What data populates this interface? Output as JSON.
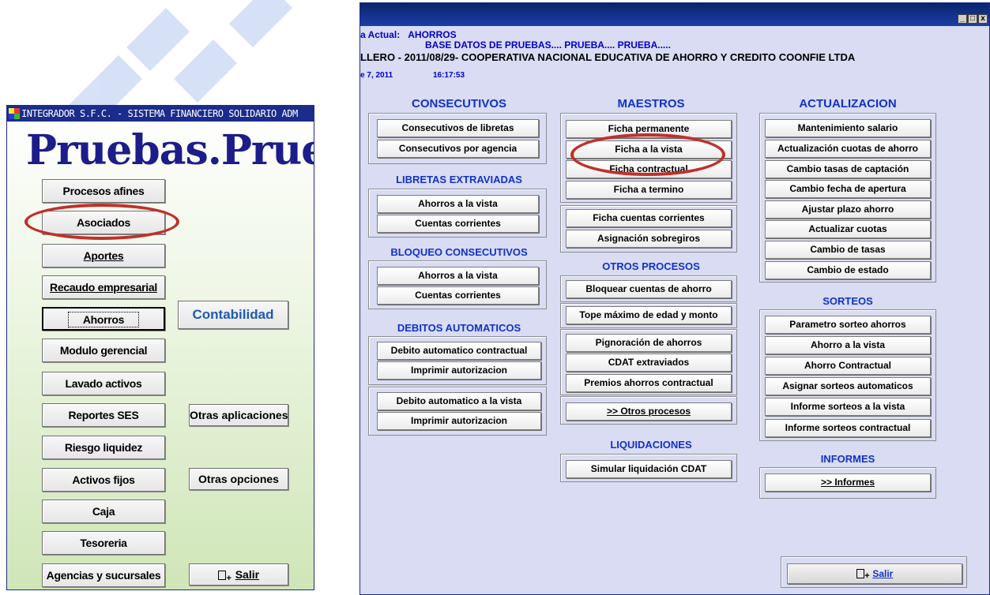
{
  "left_window": {
    "title": "INTEGRADOR  S.F.C. - SISTEMA FINANCIERO SOLIDARIO ADM",
    "app_name": "Pruebas.Prueb",
    "buttons_col1": [
      {
        "label": "Procesos afines"
      },
      {
        "label": "Asociados"
      },
      {
        "label": "Aportes"
      },
      {
        "label": "Recaudo empresarial"
      },
      {
        "label": "Ahorros"
      },
      {
        "label": "Modulo gerencial"
      },
      {
        "label": "Lavado activos"
      },
      {
        "label": "Reportes SES"
      },
      {
        "label": "Riesgo liquidez"
      },
      {
        "label": "Activos fijos"
      },
      {
        "label": "Caja"
      },
      {
        "label": "Tesoreria"
      },
      {
        "label": "Agencias y sucursales"
      }
    ],
    "contabilidad_label": "Contabilidad",
    "otras_aplicaciones_label": "Otras aplicaciones",
    "otras_opciones_label": "Otras opciones",
    "salir_label": "Salir"
  },
  "right_window": {
    "header": {
      "line1_label": "a Actual:",
      "line1_value": "AHORROS",
      "line2": "BASE DATOS DE PRUEBAS.... PRUEBA.... PRUEBA.....",
      "line3": "LLERO - 2011/08/29- COOPERATIVA NACIONAL EDUCATIVA DE AHORRO Y CREDITO COONFIE LTDA",
      "date": "e 7, 2011",
      "time": "16:17:53"
    },
    "consecutivos": {
      "title": "CONSECUTIVOS",
      "buttons": [
        "Consecutivos de libretas",
        "Consecutivos por agencia"
      ]
    },
    "libretas_extraviadas": {
      "title": "LIBRETAS EXTRAVIADAS",
      "buttons": [
        "Ahorros a la vista",
        "Cuentas corrientes"
      ]
    },
    "bloqueo_consecutivos": {
      "title": "BLOQUEO CONSECUTIVOS",
      "buttons": [
        "Ahorros a la vista",
        "Cuentas corrientes"
      ]
    },
    "debitos_automaticos": {
      "title": "DEBITOS AUTOMATICOS",
      "group1": [
        "Debito automatico contractual",
        "Imprimir autorizacion"
      ],
      "group2": [
        "Debito automatico  a la vista",
        "Imprimir autorizacion"
      ]
    },
    "maestros": {
      "title": "MAESTROS",
      "group1": [
        "Ficha permanente",
        "Ficha a la vista",
        "Ficha contractual",
        "Ficha a termino"
      ],
      "group2": [
        "Ficha cuentas corrientes",
        "Asignación sobregiros"
      ]
    },
    "otros_procesos": {
      "title": "OTROS PROCESOS",
      "buttons": [
        "Bloquear cuentas de ahorro",
        "Tope máximo de edad y monto",
        "Pignoración de ahorros",
        "CDAT extraviados",
        "Premios ahorros contractual",
        ">> Otros procesos"
      ]
    },
    "liquidaciones": {
      "title": "LIQUIDACIONES",
      "buttons": [
        "Simular liquidación CDAT"
      ]
    },
    "actualizacion": {
      "title": "ACTUALIZACION",
      "buttons": [
        "Mantenimiento salario",
        "Actualización cuotas de ahorro",
        "Cambio tasas de captación",
        "Cambio fecha de apertura",
        "Ajustar plazo ahorro",
        "Actualizar cuotas",
        "Cambio de tasas",
        "Cambio de estado"
      ]
    },
    "sorteos": {
      "title": "SORTEOS",
      "buttons": [
        "Parametro sorteo ahorros",
        "Ahorro a la vista",
        "Ahorro Contractual",
        "Asignar sorteos automaticos",
        "Informe sorteos a la vista",
        "Informe sorteos contractual"
      ]
    },
    "informes": {
      "title": "INFORMES",
      "buttons": [
        ">> Informes"
      ]
    },
    "salir_label": "Salir",
    "window_controls": [
      "_",
      "□",
      "x"
    ]
  },
  "colors": {
    "title_blue": "#1032c8",
    "highlight_red": "#c0302c",
    "panel_bg": "#d9dcf2"
  }
}
